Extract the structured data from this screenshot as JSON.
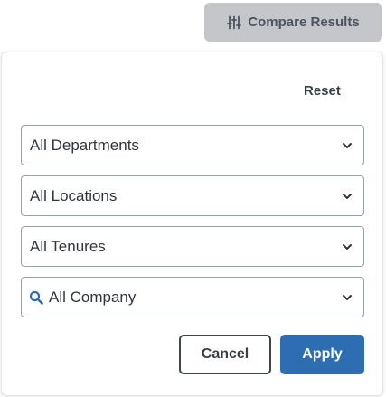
{
  "header": {
    "compare_button": {
      "label": "Compare Results",
      "icon": "sliders-icon",
      "color": "#c4c6ca"
    }
  },
  "filter_panel": {
    "reset_label": "Reset",
    "selects": [
      {
        "value": "All Departments",
        "icon": "chevron-down-icon"
      },
      {
        "value": "All Locations",
        "icon": "chevron-down-icon"
      },
      {
        "value": "All Tenures",
        "icon": "chevron-down-icon"
      },
      {
        "value": "All Company",
        "leading_icon": "search-icon",
        "icon": "chevron-down-icon"
      }
    ],
    "cancel_label": "Cancel",
    "apply_label": "Apply",
    "apply_color": "#2f6db3",
    "search_icon_color": "#2f6db3"
  }
}
